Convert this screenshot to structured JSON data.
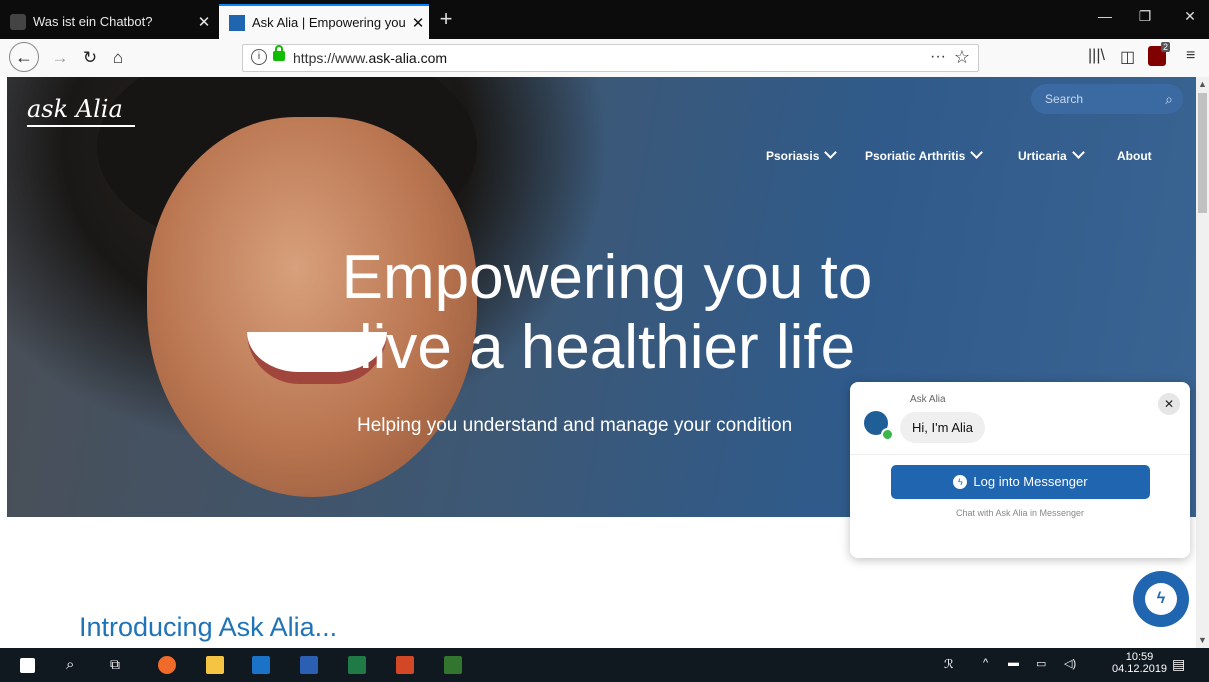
{
  "browser": {
    "tabs": [
      {
        "title": "Was ist ein Chatbot?",
        "active": false
      },
      {
        "title": "Ask Alia | Empowering you to l",
        "active": true
      }
    ],
    "url_prefix": "https://www.",
    "url_domain": "ask-alia.com",
    "url_more": "···",
    "ublock_count": "2"
  },
  "site": {
    "logo": "ask Alia",
    "search_placeholder": "Search",
    "nav": [
      "Psoriasis",
      "Psoriatic Arthritis",
      "Urticaria",
      "About"
    ],
    "hero_line1": "Empowering you to",
    "hero_line2": "live a healthier life",
    "hero_sub": "Helping you understand and manage your condition",
    "intro": "Introducing Ask Alia..."
  },
  "chat": {
    "bot_name": "Ask Alia",
    "greeting": "Hi, I'm Alia",
    "button": "Log into Messenger",
    "hint": "Chat with Ask Alia in Messenger"
  },
  "taskbar": {
    "time": "10:59",
    "date": "04.12.2019"
  },
  "colors": {
    "accent": "#1f65b0",
    "intro_text": "#1f73b7",
    "taskbar": "#101820"
  }
}
